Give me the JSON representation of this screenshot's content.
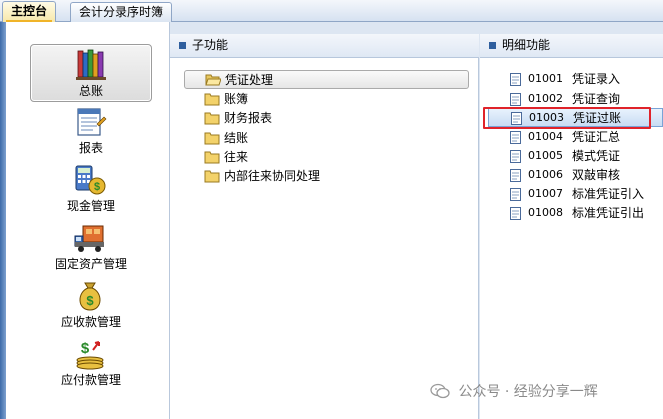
{
  "tabs": [
    {
      "label": "主控台",
      "active": true
    },
    {
      "label": "会计分录序时簿",
      "active": false
    }
  ],
  "modules": [
    {
      "label": "总账",
      "icon": "ledger-books-icon",
      "selected": true
    },
    {
      "label": "报表",
      "icon": "report-icon",
      "selected": false
    },
    {
      "label": "现金管理",
      "icon": "cash-calculator-icon",
      "selected": false
    },
    {
      "label": "固定资产管理",
      "icon": "fixed-asset-truck-icon",
      "selected": false
    },
    {
      "label": "应收款管理",
      "icon": "money-bag-icon",
      "selected": false
    },
    {
      "label": "应付款管理",
      "icon": "payable-coins-icon",
      "selected": false
    }
  ],
  "sub_panel": {
    "title": "子功能",
    "items": [
      {
        "label": "凭证处理",
        "icon": "folder-open-icon",
        "selected": true
      },
      {
        "label": "账簿",
        "icon": "folder-icon",
        "selected": false
      },
      {
        "label": "财务报表",
        "icon": "folder-icon",
        "selected": false
      },
      {
        "label": "结账",
        "icon": "folder-icon",
        "selected": false
      },
      {
        "label": "往来",
        "icon": "folder-icon",
        "selected": false
      },
      {
        "label": "内部往来协同处理",
        "icon": "folder-icon",
        "selected": false
      }
    ]
  },
  "detail_panel": {
    "title": "明细功能",
    "items": [
      {
        "code": "01001",
        "label": "凭证录入",
        "selected": false
      },
      {
        "code": "01002",
        "label": "凭证查询",
        "selected": false
      },
      {
        "code": "01003",
        "label": "凭证过账",
        "selected": true
      },
      {
        "code": "01004",
        "label": "凭证汇总",
        "selected": false
      },
      {
        "code": "01005",
        "label": "模式凭证",
        "selected": false
      },
      {
        "code": "01006",
        "label": "双敲审核",
        "selected": false
      },
      {
        "code": "01007",
        "label": "标准凭证引入",
        "selected": false
      },
      {
        "code": "01008",
        "label": "标准凭证引出",
        "selected": false
      }
    ]
  },
  "watermark": {
    "text": "公众号 · 经验分享一辉",
    "icon": "wechat-icon"
  },
  "colors": {
    "accent": "#2f5f9e",
    "highlight_box": "#e0232a",
    "tab_active": "#f7e7a6"
  }
}
